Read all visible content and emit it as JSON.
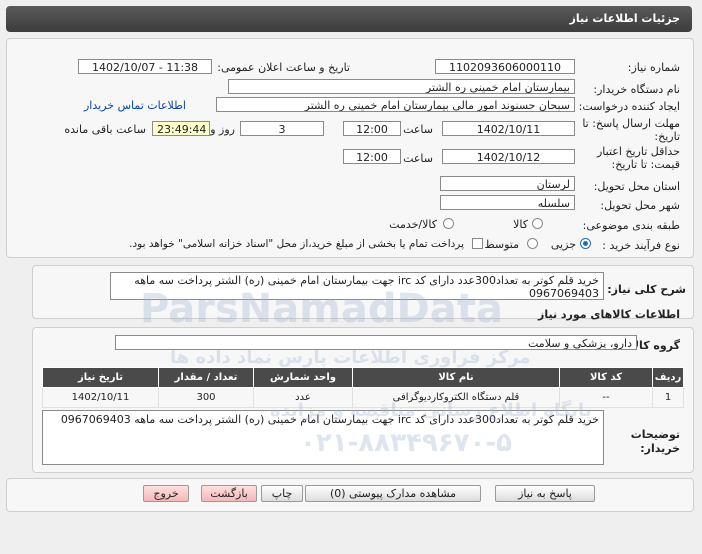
{
  "header": {
    "title": "جزئیات اطلاعات نیاز"
  },
  "fields": {
    "need_number": {
      "label": "شماره نیاز:",
      "value": "1102093606000110"
    },
    "announce_datetime": {
      "label": "تاریخ و ساعت اعلان عمومی:",
      "value": "1402/10/07 - 11:38"
    },
    "buyer_org": {
      "label": "نام دستگاه خریدار:",
      "value": "بیمارستان امام خمینی ره الشتر"
    },
    "requester": {
      "label": "ایجاد کننده درخواست:",
      "value": "سبحان حسنوند امور مالی بیمارستان امام خمینی ره الشتر",
      "link": "اطلاعات تماس خریدار"
    },
    "reply_deadline": {
      "label_line1": "مهلت ارسال پاسخ: تا",
      "label_line2": "تاریخ:",
      "date": "1402/10/11",
      "time_label": "ساعت",
      "time": "12:00",
      "days": "3",
      "days_label": "روز و",
      "remaining": "23:49:44",
      "remaining_label": "ساعت باقی مانده"
    },
    "validity": {
      "label_line1": "حداقل تاریخ اعتبار",
      "label_line2": "قیمت: تا تاریخ:",
      "date": "1402/10/12",
      "time_label": "ساعت",
      "time": "12:00"
    },
    "province": {
      "label": "استان محل تحویل:",
      "value": "لرستان"
    },
    "city": {
      "label": "شهر محل تحویل:",
      "value": "سلسله"
    },
    "category": {
      "label": "طبقه بندی موضوعی:",
      "options": [
        "کالا",
        "کالا/خدمت"
      ]
    },
    "process": {
      "label": "نوع فرآیند خرید :",
      "options": [
        "جزیی",
        "متوسط"
      ],
      "selected": "جزیی",
      "note": "پرداخت تمام یا بخشی از مبلغ خرید،از محل \"اسناد خزانه اسلامی\" خواهد بود."
    }
  },
  "description": {
    "label": "شرح کلی نیاز:",
    "value": "خرید قلم کوتر به تعداد300عدد دارای کد irc جهت بیمارستان امام خمینی (ره) الشتر پرداخت سه ماهه 0967069403"
  },
  "goods_section": {
    "title": "اطلاعات کالاهای مورد نیاز",
    "group_label": "گروه کالا:",
    "group_value": "دارو، پزشکی و سلامت",
    "columns": [
      "ردیف",
      "کد کالا",
      "نام کالا",
      "واحد شمارش",
      "تعداد / مقدار",
      "تاریخ نیاز"
    ],
    "rows": [
      [
        "1",
        "--",
        "قلم دستگاه الکتروکاردیوگرافی",
        "عدد",
        "300",
        "1402/10/11"
      ]
    ],
    "buyer_notes_label_line1": "توضیحات",
    "buyer_notes_label_line2": "خریدار:",
    "buyer_notes": "خرید قلم کوتر به تعداد300عدد دارای کد irc جهت بیمارستان امام خمینی (ره) الشتر پرداخت سه ماهه 0967069403"
  },
  "buttons": {
    "reply": "پاسخ به نیاز",
    "attachments": "مشاهده مدارک پیوستی (0)",
    "print": "چاپ",
    "back": "بازگشت",
    "exit": "خروج"
  },
  "watermarks": {
    "brand": "ParsNamadData",
    "persian": "مرکز فراوری اطلاعات پارس نماد داده ها",
    "persian2": "پایگاه اطلاع رسانی مناقصه و مزایده",
    "phone": "۰۲۱-۸۸۳۴۹۶۷۰-۵"
  }
}
